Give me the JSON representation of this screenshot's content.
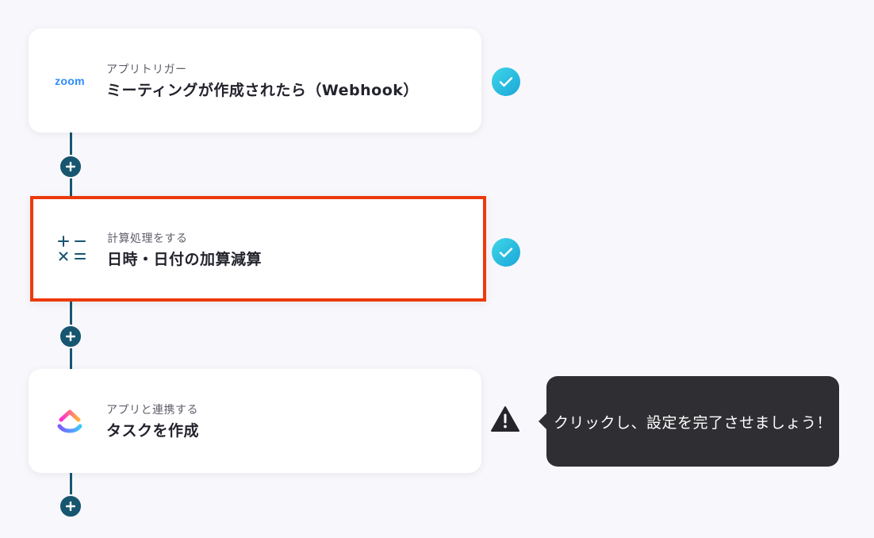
{
  "steps": [
    {
      "subtitle": "アプリトリガー",
      "title": "ミーティングが作成されたら（Webhook）",
      "icon": "zoom-logo",
      "icon_text": "zoom",
      "status": "complete"
    },
    {
      "subtitle": "計算処理をする",
      "title": "日時・日付の加算減算",
      "icon": "calculator-operators-icon",
      "status": "complete",
      "selected": true
    },
    {
      "subtitle": "アプリと連携する",
      "title": "タスクを作成",
      "icon": "clickup-logo",
      "status": "warning"
    }
  ],
  "tooltip": {
    "text": "クリックし、設定を完了させましょう！"
  },
  "colors": {
    "background": "#f8f7fb",
    "connector": "#17566f",
    "selected_border": "#ec3a0d",
    "check": "#1aa6d8",
    "tooltip_bg": "#2f2f33",
    "zoom_blue": "#2d8cff"
  }
}
